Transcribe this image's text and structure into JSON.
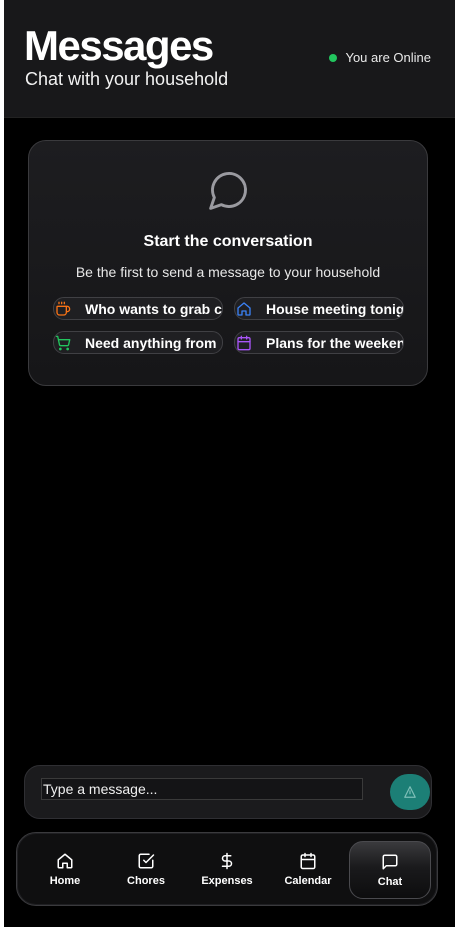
{
  "header": {
    "title": "Messages",
    "subtitle": "Chat with your household",
    "status_text": "You are Online",
    "status_color": "#22c55e"
  },
  "empty_state": {
    "icon": "chat-bubble-icon",
    "title": "Start the conversation",
    "subtitle": "Be the first to send a message to your household",
    "suggestions": [
      {
        "label": "Who wants to grab c",
        "icon": "coffee-icon",
        "color": "#f97316"
      },
      {
        "label": "House meeting tonig",
        "icon": "home-icon",
        "color": "#3b82f6"
      },
      {
        "label": "Need anything from ",
        "icon": "cart-icon",
        "color": "#22c55e"
      },
      {
        "label": "Plans for the weeken",
        "icon": "calendar-icon",
        "color": "#a855f7"
      }
    ]
  },
  "composer": {
    "placeholder": "Type a message...",
    "send_icon": "send-icon",
    "send_color": "#1c7f76"
  },
  "tabbar": {
    "tabs": [
      {
        "label": "Home",
        "icon": "home-icon"
      },
      {
        "label": "Chores",
        "icon": "check-square-icon"
      },
      {
        "label": "Expenses",
        "icon": "dollar-icon"
      },
      {
        "label": "Calendar",
        "icon": "calendar-icon"
      },
      {
        "label": "Chat",
        "icon": "chat-icon",
        "active": true
      }
    ]
  }
}
